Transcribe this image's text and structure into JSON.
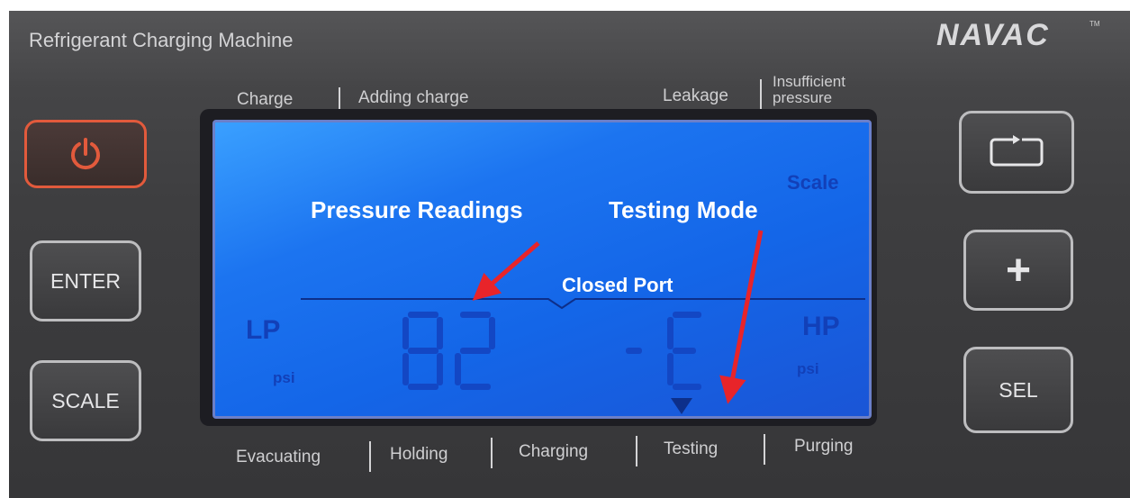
{
  "header": {
    "machine_title": "Refrigerant Charging Machine",
    "brand": "NAVAC",
    "trademark": "TM"
  },
  "top_indicators": {
    "charge": "Charge",
    "adding_charge": "Adding charge",
    "leakage": "Leakage",
    "insufficient_line1": "Insufficient",
    "insufficient_line2": "pressure"
  },
  "buttons": {
    "enter": "ENTER",
    "scale": "SCALE",
    "sel": "SEL",
    "plus": "+"
  },
  "lcd": {
    "scale_label": "Scale",
    "lp_label": "LP",
    "lp_unit": "psi",
    "hp_label": "HP",
    "hp_unit": "psi",
    "lp_reading": "82",
    "hp_reading": "-E",
    "accent_color": "#1466e8"
  },
  "annotations": {
    "pressure_readings": "Pressure Readings",
    "testing_mode": "Testing Mode",
    "closed_port": "Closed Port",
    "arrow_color": "#e8242a"
  },
  "modes": [
    "Evacuating",
    "Holding",
    "Charging",
    "Testing",
    "Purging"
  ]
}
